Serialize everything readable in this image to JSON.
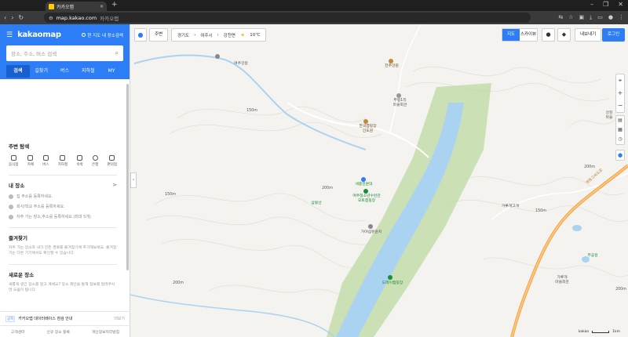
{
  "browser": {
    "tab_title": "카카오맵",
    "url_domain": "map.kakao.com",
    "url_title": "카카오맵",
    "new_tab": "+",
    "win_min": "–",
    "win_max": "❐",
    "win_close": "✕"
  },
  "sidebar": {
    "brand": "kakaomap",
    "toggle_label": "현 지도 내 장소검색",
    "search_placeholder": "장소, 주소, 버스 검색",
    "tabs": [
      {
        "label": "검색",
        "active": true
      },
      {
        "label": "길찾기"
      },
      {
        "label": "버스"
      },
      {
        "label": "지하철"
      },
      {
        "label": "MY"
      }
    ],
    "nearby": {
      "title": "주변 탐색",
      "categories": [
        "음식점",
        "카페",
        "버스",
        "지하철",
        "숙박",
        "은행",
        "편의점"
      ]
    },
    "my_places": {
      "title": "내 장소",
      "link": ">",
      "items": [
        "집 주소를 등록하세요.",
        "회사/학교 주소를 등록하세요.",
        "자주 가는 장소,주소를 등록하세요.(최대 5개)"
      ]
    },
    "favorites": {
      "title": "즐겨찾기",
      "desc": "자주 가는 장소와 내가 만든 경로를 즐겨찾기에 추가해보세요. 즐겨찾기는 다른 기기에서도 확인할 수 있습니다."
    },
    "new_place": {
      "title": "새로운 장소",
      "desc": "새롭게 생긴 장소를 알고 계세요? 장소 제안을 통해 정보를 알려주시면 도움이 됩니다."
    },
    "notice": {
      "badge": "공지",
      "text": "카카오맵 데이터베이스 점검 안내",
      "more": "더보기"
    },
    "footer": [
      "고객센터",
      "신규 장소 등록",
      "개인정보처리방침"
    ]
  },
  "map": {
    "around_btn": "주변",
    "location": {
      "province": "경기도",
      "city": "여주시",
      "town": "강천면",
      "temp": "10℃"
    },
    "map_types": [
      {
        "label": "지도",
        "active": true
      },
      {
        "label": "스카이뷰"
      }
    ],
    "share_btn": "내보내기",
    "login_btn": "로그인",
    "labels": [
      {
        "text": "여주강원"
      },
      {
        "text": "전주강원"
      },
      {
        "text": "부평1리\n마을회관"
      },
      {
        "text": "한국캠핑장\n인도원"
      },
      {
        "text": "세종천문대"
      },
      {
        "text": "여주청소년수련관\n오토캠핑장"
      },
      {
        "text": "가야섬유원지"
      },
      {
        "text": "도메이캠핑장"
      },
      {
        "text": "삼봉산"
      },
      {
        "text": "가루개고개"
      },
      {
        "text": "가루개\n마을회관"
      },
      {
        "text": "강천\n마을"
      },
      {
        "text": "무공원"
      },
      {
        "text": "영동고속도로"
      }
    ],
    "elevations": [
      "150m",
      "200m",
      "150m",
      "150m",
      "200m",
      "200m",
      "200m"
    ],
    "scale_label": "1km",
    "logo": "kakao"
  },
  "colors": {
    "accent": "#2d7df6",
    "park": "#bfd9a2",
    "river": "#a9d3f0",
    "highway": "#f2a24a"
  }
}
